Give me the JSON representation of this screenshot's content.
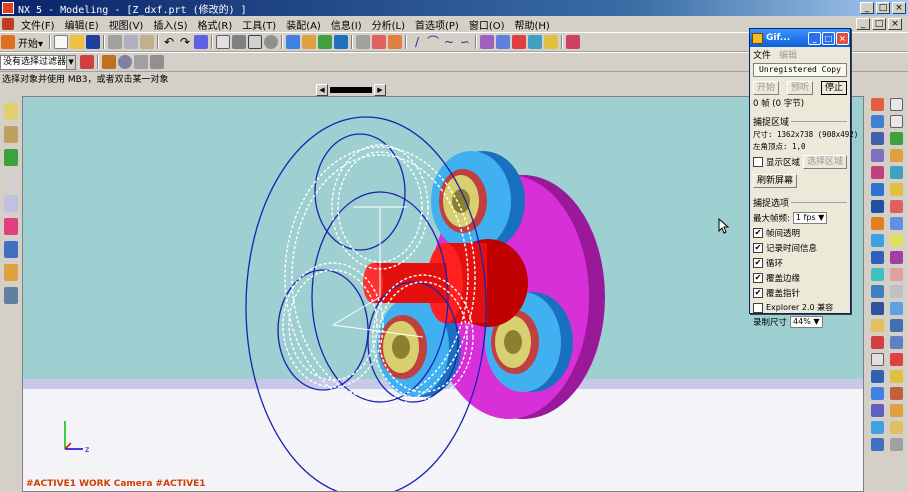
{
  "window": {
    "title": "NX 5 - Modeling - [Z_dxf.prt  (修改的) ]"
  },
  "menu": [
    "文件(F)",
    "编辑(E)",
    "视图(V)",
    "插入(S)",
    "格式(R)",
    "工具(T)",
    "装配(A)",
    "信息(I)",
    "分析(L)",
    "首选项(P)",
    "窗口(O)",
    "帮助(H)"
  ],
  "toolbar": {
    "start_label": "开始▾"
  },
  "selection": {
    "filter_value": "没有选择过滤器"
  },
  "prompt": "选择对象并使用 MB3，或者双击某一对象",
  "viewport": {
    "camera_label": "#ACTIVE1 WORK Camera #ACTIVE1"
  },
  "dialog": {
    "title": "Gif...",
    "menu_file": "文件",
    "menu_edit": "编辑",
    "unregistered": "Unregistered Copy",
    "btn_start": "开始",
    "btn_pause": "预听",
    "btn_stop": "停止",
    "frames": "0 帧 (0 字节)",
    "capture_region_title": "捕捉区域",
    "size_line": "尺寸: 1362x738 (908x492)",
    "origin_line": "左角顶点:     1,0",
    "show_region": "显示区域",
    "select_region": "选择区域",
    "refresh_screen": "刷新屏幕",
    "capture_options_title": "捕捉选项",
    "max_fps_label": "最大帧频:",
    "max_fps_value": "1 fps ▼",
    "opt_transparent": "帧间透明",
    "opt_timestamp": "记录时间信息",
    "opt_loop": "循环",
    "opt_border": "覆盖边缘",
    "opt_pointer": "覆盖指针",
    "opt_explorer": "Explorer 2.0 兼容",
    "record_size_label": "录制尺寸",
    "record_size_value": "44% ▼"
  },
  "colors": {
    "viewport_top": "#9ecfd1",
    "viewport_bottom": "#f4f4f8",
    "gear_wire": "#ffffff",
    "circle_wire": "#1a22b0",
    "shaft": "#e01010",
    "carrier": "#c020c0",
    "planet_ring": "#3aa0e8",
    "bearing": "#c8c050",
    "camera_label": "#d04000"
  },
  "icons": {
    "toolbar_row1": [
      "start-icon",
      "new-icon",
      "open-icon",
      "save-icon",
      "cut-icon",
      "copy-icon",
      "paste-icon",
      "undo-icon",
      "redo-icon",
      "brush-icon",
      "fit-icon",
      "shaded-icon",
      "wireframe-icon",
      "zoom-icon",
      "rotate-icon",
      "layer-icon",
      "color-icon",
      "view-icon",
      "point-icon",
      "dimension-icon",
      "line-icon",
      "arc-icon",
      "spline-icon",
      "curve-icon",
      "blend-icon",
      "extrude-icon",
      "revolve-icon",
      "chamfer-icon",
      "edit-icon",
      "measure-icon",
      "analysis-icon"
    ]
  }
}
